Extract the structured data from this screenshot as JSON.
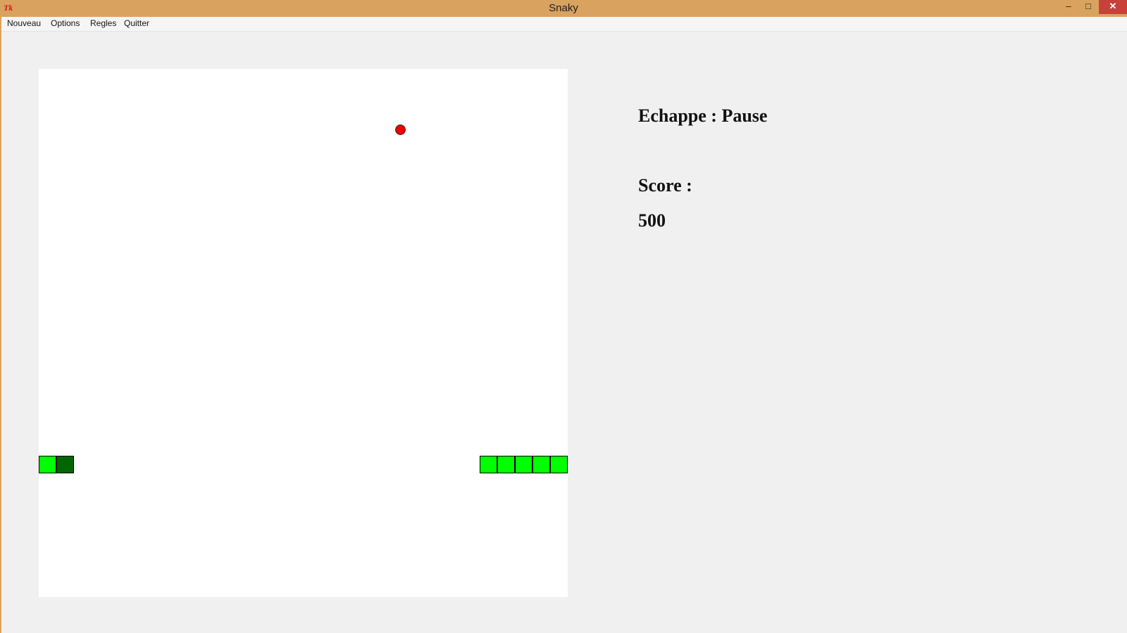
{
  "window": {
    "icon": "tk-icon",
    "title": "Snaky",
    "controls": {
      "minimize": "–",
      "maximize": "□",
      "close": "✕"
    }
  },
  "menu": {
    "items": [
      "Nouveau",
      "Options",
      "Regles",
      "Quitter"
    ]
  },
  "game": {
    "board_color": "#ffffff",
    "food_color": "#ee0000",
    "snake_body_color": "#00ff00",
    "snake_head_color": "#006600"
  },
  "info": {
    "pause_hint": "Echappe : Pause",
    "score_label": "Score :",
    "score_value": "500"
  }
}
